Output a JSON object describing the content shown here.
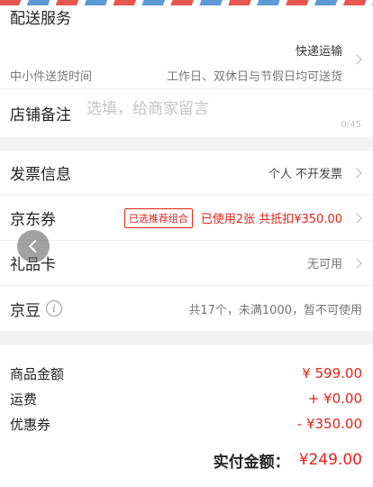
{
  "delivery": {
    "title": "配送服务",
    "method": "快递运输",
    "subtitle": "中小件送货时间",
    "time": "工作日、双休日与节假日均可送货"
  },
  "remark": {
    "title": "店铺备注",
    "placeholder": "选填，给商家留言",
    "count": "0/45"
  },
  "invoice": {
    "title": "发票信息",
    "value": "个人 不开发票"
  },
  "coupon": {
    "title": "京东券",
    "badge": "已选推荐组合",
    "value": "已使用2张 共抵扣¥350.00"
  },
  "giftcard": {
    "title": "礼品卡",
    "value": "无可用"
  },
  "jingdou": {
    "title": "京豆",
    "value": "共17个，未满1000，暂不可使用"
  },
  "summary": {
    "rows": [
      {
        "label": "商品金额",
        "value": "¥ 599.00"
      },
      {
        "label": "运费",
        "value": "+ ¥0.00"
      },
      {
        "label": "优惠券",
        "value": "- ¥350.00"
      }
    ],
    "total_label": "实付金额：",
    "total_value": "¥249.00"
  },
  "colors": {
    "accent_red": "#e2231a",
    "stripe_red": "#e8554e",
    "stripe_blue": "#5b9bd5"
  }
}
